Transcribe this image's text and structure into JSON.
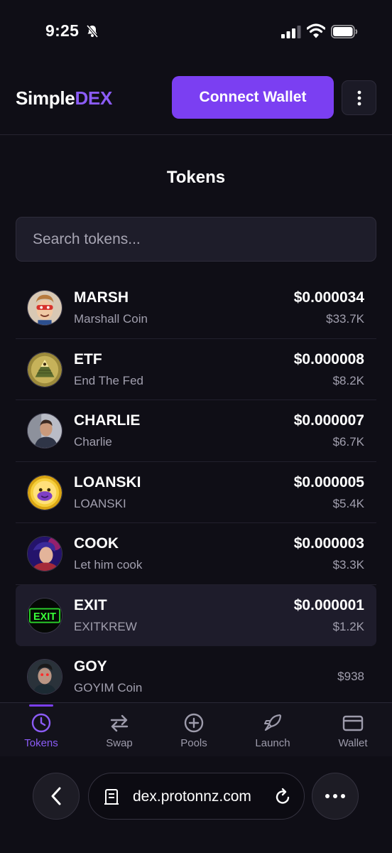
{
  "status": {
    "time": "9:25"
  },
  "header": {
    "brand_part1": "Simple",
    "brand_part2": "DEX",
    "connect_label": "Connect Wallet",
    "accent": "#7b3ff2"
  },
  "page": {
    "title": "Tokens"
  },
  "search": {
    "placeholder": "Search tokens...",
    "value": ""
  },
  "tokens": [
    {
      "symbol": "MARSH",
      "name": "Marshall Coin",
      "price": "$0.000034",
      "mcap": "$33.7K"
    },
    {
      "symbol": "ETF",
      "name": "End The Fed",
      "price": "$0.000008",
      "mcap": "$8.2K"
    },
    {
      "symbol": "CHARLIE",
      "name": "Charlie",
      "price": "$0.000007",
      "mcap": "$6.7K"
    },
    {
      "symbol": "LOANSKI",
      "name": "LOANSKI",
      "price": "$0.000005",
      "mcap": "$5.4K"
    },
    {
      "symbol": "COOK",
      "name": "Let him cook",
      "price": "$0.000003",
      "mcap": "$3.3K"
    },
    {
      "symbol": "EXIT",
      "name": "EXITKREW",
      "price": "$0.000001",
      "mcap": "$1.2K",
      "avatar_text": "EXIT"
    },
    {
      "symbol": "GOY",
      "name": "GOYIM Coin",
      "price": "",
      "mcap": "$938"
    }
  ],
  "nav": [
    {
      "label": "Tokens",
      "icon": "clock-icon",
      "active": true
    },
    {
      "label": "Swap",
      "icon": "swap-arrows-icon",
      "active": false
    },
    {
      "label": "Pools",
      "icon": "plus-circle-icon",
      "active": false
    },
    {
      "label": "Launch",
      "icon": "rocket-icon",
      "active": false
    },
    {
      "label": "Wallet",
      "icon": "card-icon",
      "active": false
    }
  ],
  "browser": {
    "url": "dex.protonnz.com"
  }
}
